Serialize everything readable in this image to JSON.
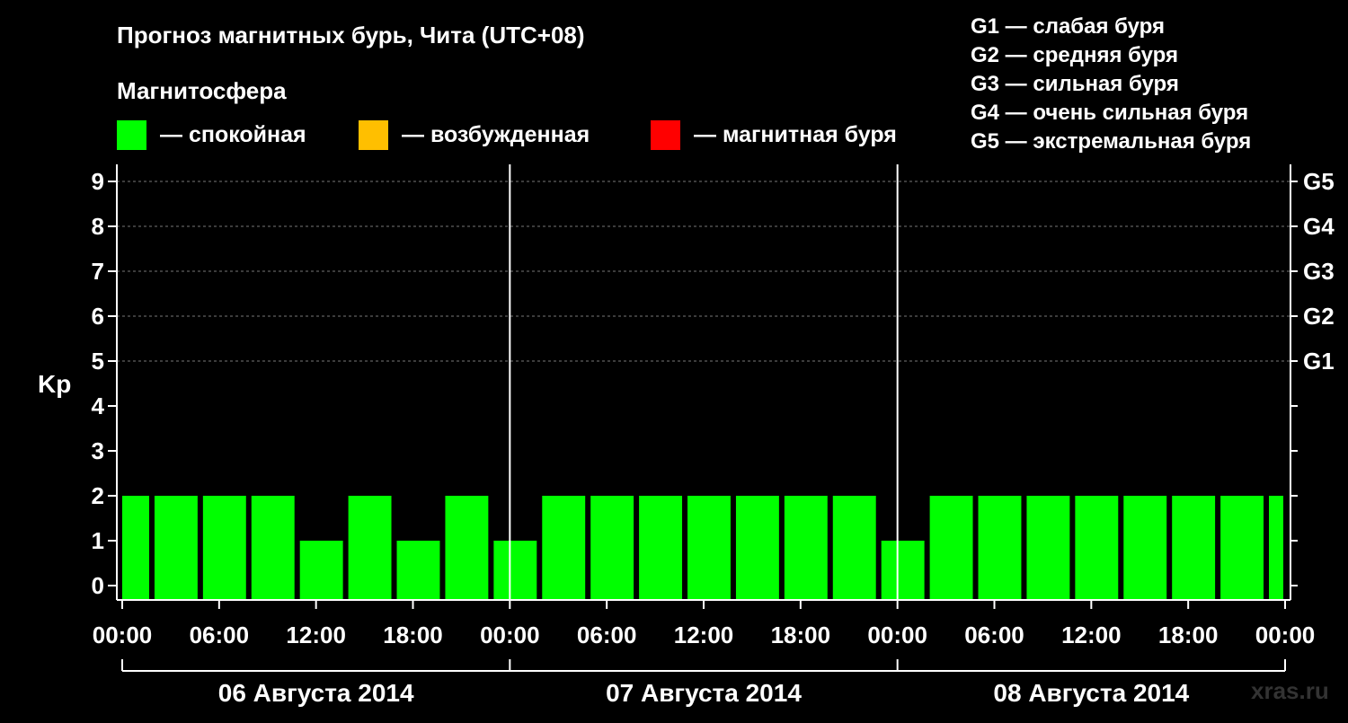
{
  "chart_data": {
    "type": "bar",
    "title": "Прогноз магнитных бурь, Чита (UTC+08)",
    "legend_title": "Магнитосфера",
    "legend": [
      {
        "label": "— спокойная",
        "color": "#00ff00"
      },
      {
        "label": "— возбужденная",
        "color": "#ffbf00"
      },
      {
        "label": "— магнитная буря",
        "color": "#ff0000"
      }
    ],
    "g_legend": [
      "G1 — слабая буря",
      "G2 — средняя буря",
      "G3 — сильная буря",
      "G4 — очень сильная буря",
      "G5 — экстремальная буря"
    ],
    "ylabel": "Kp",
    "ylim": [
      0,
      9
    ],
    "yticks": [
      "0",
      "1",
      "2",
      "3",
      "4",
      "5",
      "6",
      "7",
      "8",
      "9"
    ],
    "right_ticks": [
      {
        "value": 5,
        "label": "G1"
      },
      {
        "value": 6,
        "label": "G2"
      },
      {
        "value": 7,
        "label": "G3"
      },
      {
        "value": 8,
        "label": "G4"
      },
      {
        "value": 9,
        "label": "G5"
      }
    ],
    "grid_levels": [
      5,
      6,
      7,
      8,
      9
    ],
    "xticks": [
      "00:00",
      "06:00",
      "12:00",
      "18:00",
      "00:00",
      "06:00",
      "12:00",
      "18:00",
      "00:00",
      "06:00",
      "12:00",
      "18:00",
      "00:00"
    ],
    "days": [
      "06 Августа 2014",
      "07 Августа 2014",
      "08 Августа 2014"
    ],
    "bar_interval_hours": 3,
    "first_bar_offset_hours": -1,
    "values": [
      2,
      2,
      2,
      2,
      1,
      2,
      1,
      2,
      1,
      2,
      2,
      2,
      2,
      2,
      2,
      2,
      1,
      2,
      2,
      2,
      2,
      2,
      2,
      2,
      2
    ],
    "bar_color": "#00ff00",
    "grid": true
  },
  "watermark": "xras.ru"
}
